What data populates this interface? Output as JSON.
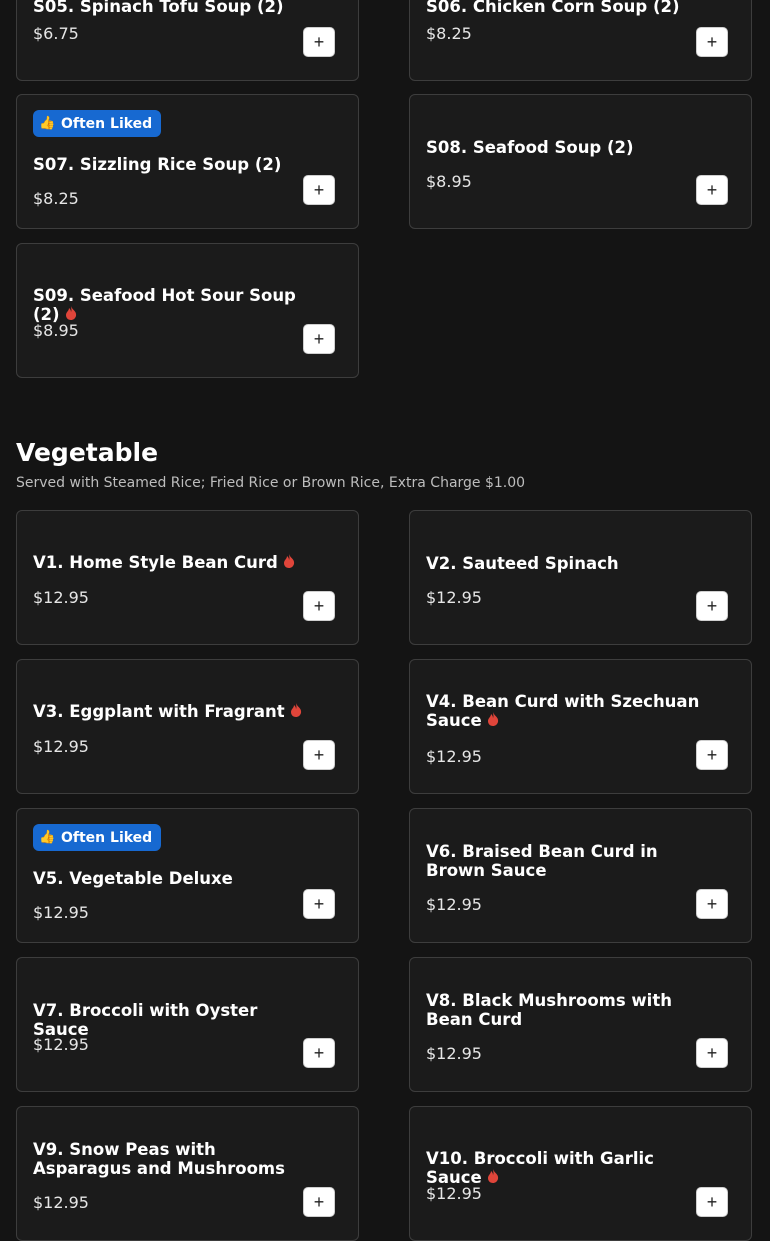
{
  "soups": {
    "items": [
      {
        "title": "S05. Spinach Tofu Soup (2)",
        "price": "$6.75"
      },
      {
        "title": "S06. Chicken Corn Soup (2)",
        "price": "$8.25"
      },
      {
        "title": "S07. Sizzling Rice Soup (2)",
        "price": "$8.25",
        "badge": "Often Liked"
      },
      {
        "title": "S08. Seafood Soup (2)",
        "price": "$8.95"
      },
      {
        "title": "S09. Seafood Hot Sour Soup (2)",
        "price": "$8.95",
        "spicy": true
      }
    ]
  },
  "vegetable": {
    "heading": "Vegetable",
    "note": "Served with Steamed Rice; Fried Rice or Brown Rice, Extra Charge $1.00",
    "items": [
      {
        "title": "V1. Home Style Bean Curd",
        "price": "$12.95",
        "spicy": true
      },
      {
        "title": "V2. Sauteed Spinach",
        "price": "$12.95"
      },
      {
        "title": "V3. Eggplant with Fragrant",
        "price": "$12.95",
        "spicy": true
      },
      {
        "title": "V4. Bean Curd with Szechuan Sauce",
        "price": "$12.95",
        "spicy": true
      },
      {
        "title": "V5. Vegetable Deluxe",
        "price": "$12.95",
        "badge": "Often Liked"
      },
      {
        "title": "V6. Braised Bean Curd in Brown Sauce",
        "price": "$12.95"
      },
      {
        "title": "V7. Broccoli with Oyster Sauce",
        "price": "$12.95"
      },
      {
        "title": "V8. Black Mushrooms with Bean Curd",
        "price": "$12.95"
      },
      {
        "title": "V9. Snow Peas with Asparagus and Mushrooms",
        "price": "$12.95"
      },
      {
        "title": "V10. Broccoli with Garlic Sauce",
        "price": "$12.95",
        "spicy": true
      }
    ]
  },
  "ui": {
    "add_label": "+",
    "badge_icon": "thumbs-up-icon",
    "spicy_icon": "flame-icon",
    "accent": "#1769d1",
    "spicy_color": "#e0453a"
  }
}
